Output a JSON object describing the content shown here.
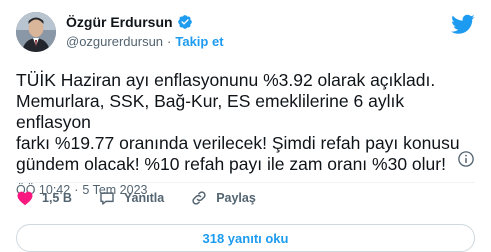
{
  "author": {
    "display_name": "Özgür Erdursun",
    "handle": "@ozgurerdursun",
    "separator": "·",
    "follow_label": "Takip et"
  },
  "tweet": {
    "text": "TÜİK Haziran ayı enflasyonunu %3.92 olarak açıkladı.\nMemurlara, SSK, Bağ-Kur, ES emeklilerine 6 aylık enflasyon\nfarkı %19.77 oranında verilecek! Şimdi refah payı konusu\ngündem olacak! %10 refah payı ile zam oranı %30 olur!",
    "time": "ÖÖ 10:42",
    "separator": "·",
    "date": "5 Tem 2023"
  },
  "actions": {
    "like_count": "1,5 B",
    "reply_label": "Yanıtla",
    "share_label": "Paylaş"
  },
  "replies_button_label": "318 yanıtı oku",
  "colors": {
    "accent": "#1d9bf0",
    "like_red": "#f91880",
    "text": "#0f1419",
    "muted": "#536471"
  },
  "icons": [
    "avatar",
    "verified-badge-icon",
    "twitter-bird-icon",
    "info-icon",
    "heart-icon",
    "reply-icon",
    "share-link-icon"
  ]
}
